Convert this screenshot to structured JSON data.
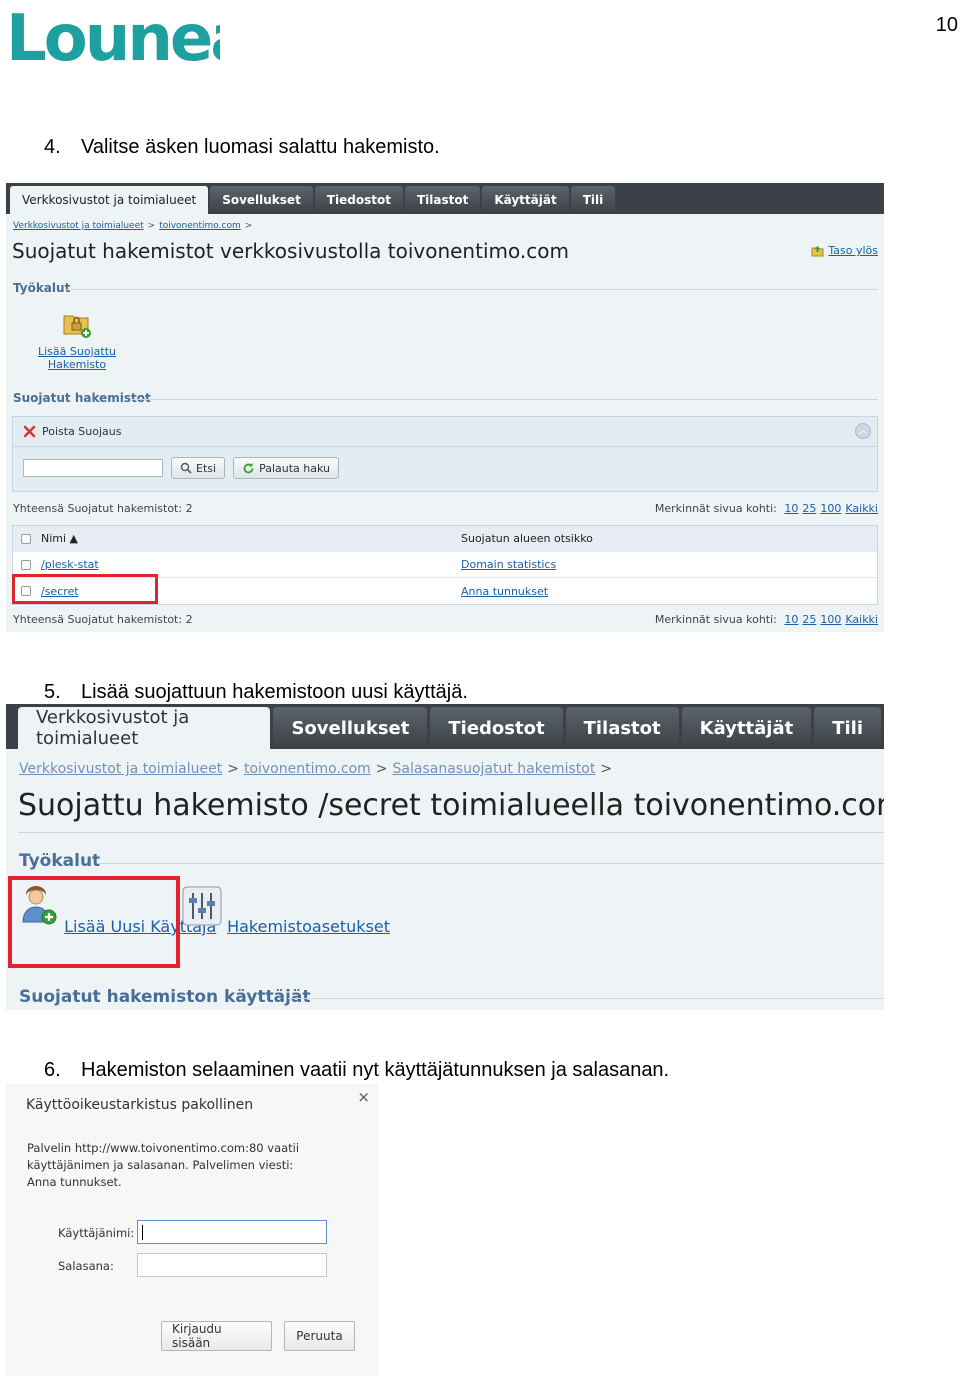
{
  "header": {
    "logo_text": "Lounea",
    "page_number": "10",
    "brand_color": "#1fa0a0"
  },
  "steps": [
    {
      "num": "4.",
      "text": "Valitse äsken luomasi salattu hakemisto."
    },
    {
      "num": "5.",
      "text": "Lisää suojattuun hakemistoon uusi käyttäjä."
    },
    {
      "num": "6.",
      "text": "Hakemiston selaaminen vaatii nyt käyttäjätunnuksen ja salasanan."
    }
  ],
  "shot1": {
    "tabs": [
      "Verkkosivustot ja toimialueet",
      "Sovellukset",
      "Tiedostot",
      "Tilastot",
      "Käyttäjät",
      "Tili"
    ],
    "breadcrumb": [
      "Verkkosivustot ja toimialueet",
      "toivonentimo.com"
    ],
    "breadcrumb_sep": ">",
    "title": "Suojatut hakemistot verkkosivustolla toivonentimo.com",
    "up_link": "Taso ylös",
    "tools_heading": "Työkalut",
    "tool_label_1": "Lisää Suojattu",
    "tool_label_2": "Hakemisto",
    "list_heading": "Suojatut hakemistot",
    "remove_label": "Poista Suojaus",
    "search_button": "Etsi",
    "reset_button": "Palauta haku",
    "total_text": "Yhteensä Suojatut hakemistot: 2",
    "per_page_label": "Merkinnät sivua kohti:",
    "per_page_options": [
      "10",
      "25",
      "100",
      "Kaikki"
    ],
    "columns": [
      "Nimi",
      "Suojatun alueen otsikko"
    ],
    "rows": [
      {
        "name": "/plesk-stat",
        "realm": "Domain statistics"
      },
      {
        "name": "/secret",
        "realm": "Anna tunnukset"
      }
    ]
  },
  "shot2": {
    "tabs": [
      "Verkkosivustot ja toimialueet",
      "Sovellukset",
      "Tiedostot",
      "Tilastot",
      "Käyttäjät",
      "Tili"
    ],
    "breadcrumb": [
      "Verkkosivustot ja toimialueet",
      "toivonentimo.com",
      "Salasanasuojatut hakemistot"
    ],
    "breadcrumb_sep": ">",
    "title": "Suojattu hakemisto /secret toimialueella toivonentimo.com",
    "tools_heading": "Työkalut",
    "add_user": "Lisää Uusi Käyttäjä",
    "dir_settings": "Hakemistoasetukset",
    "users_heading": "Suojatut hakemiston käyttäjät"
  },
  "shot3": {
    "title": "Käyttöoikeustarkistus pakollinen",
    "close_glyph": "×",
    "message": "Palvelin http://www.toivonentimo.com:80 vaatii käyttäjänimen ja salasanan. Palvelimen viesti: Anna tunnukset.",
    "username_label": "Käyttäjänimi:",
    "password_label": "Salasana:",
    "login_button": "Kirjaudu sisään",
    "cancel_button": "Peruuta"
  },
  "highlight_color": "#e0242b"
}
